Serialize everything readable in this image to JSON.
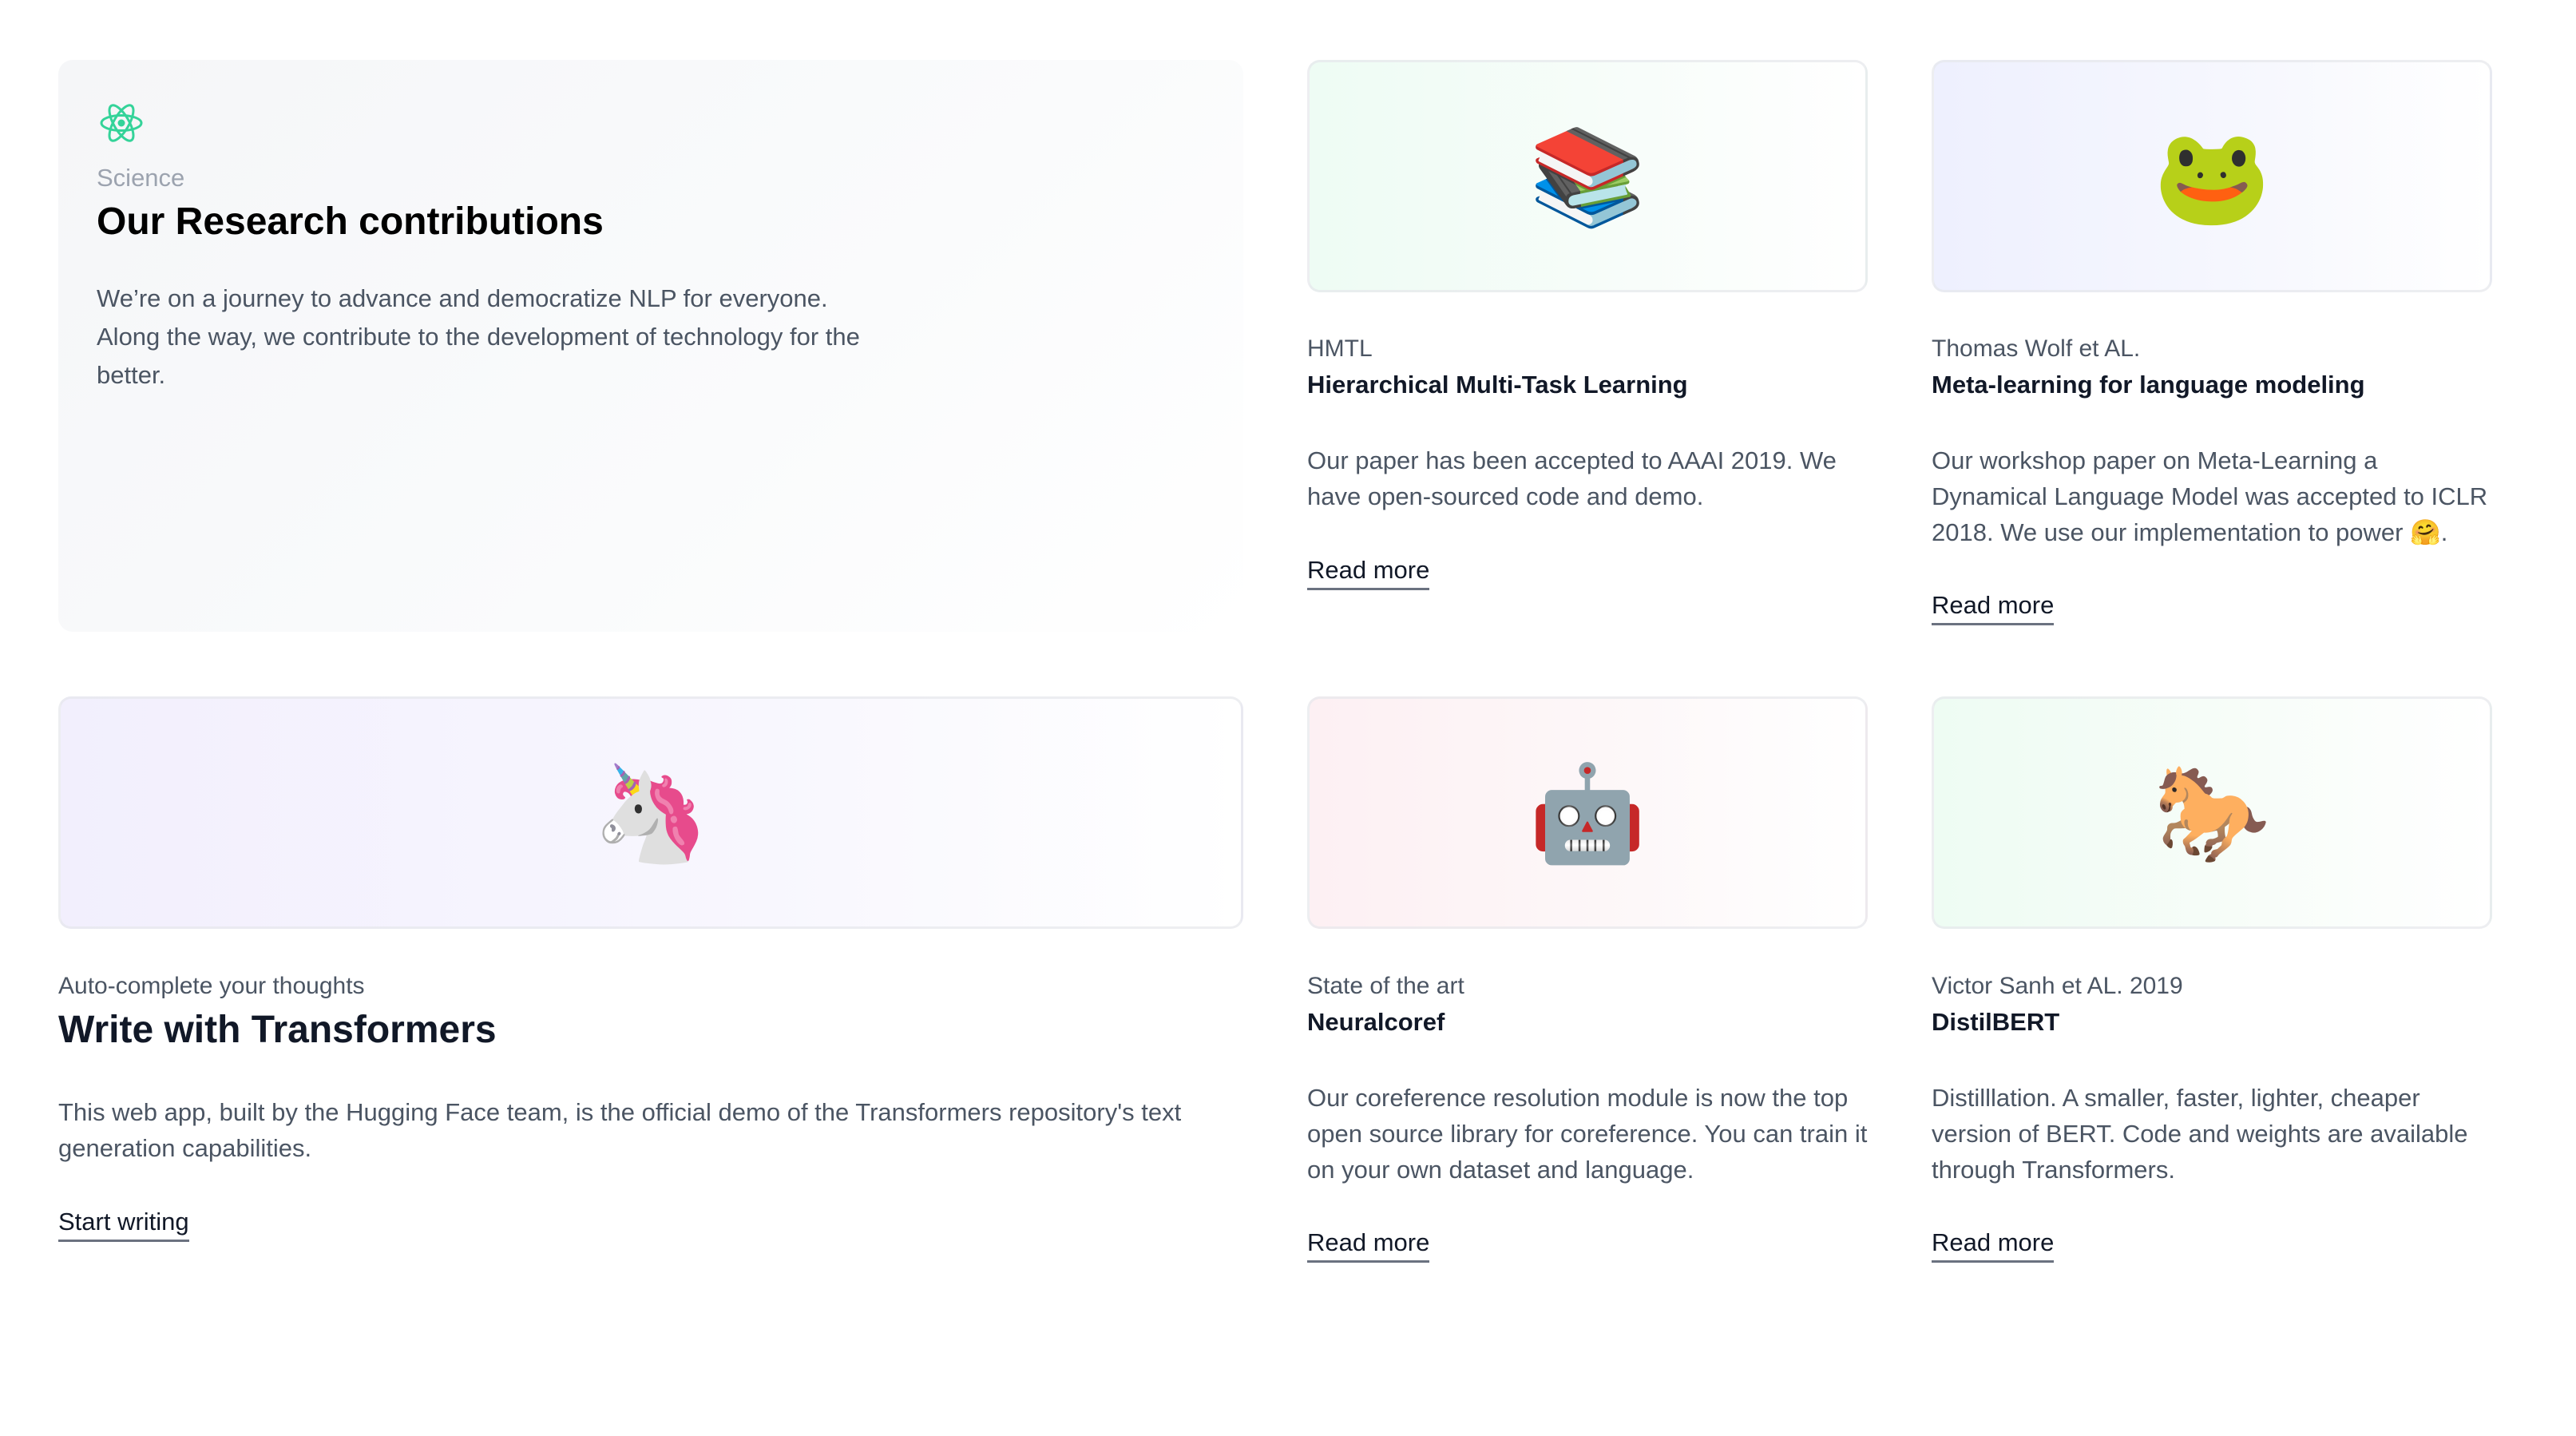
{
  "intro": {
    "icon": "atom-icon",
    "eyebrow": "Science",
    "title": "Our Research contributions",
    "description": "We’re on a journey to advance and democratize NLP for everyone. Along the way, we contribute to the development of technology for the better.",
    "accent_color": "#34d399"
  },
  "cards": {
    "hmtl": {
      "emoji": "📚",
      "icon": "books-icon",
      "eyebrow": "HMTL",
      "title": "Hierarchical Multi-Task Learning",
      "description": "Our paper has been accepted to AAAI 2019. We have open-sourced code and demo.",
      "link": "Read more"
    },
    "meta": {
      "emoji": "🐸",
      "icon": "frog-icon",
      "eyebrow": "Thomas Wolf et AL.",
      "title": "Meta-learning for language modeling",
      "description": "Our workshop paper on Meta-Learning a Dynamical Language Model was accepted to ICLR 2018. We use our implementation to power 🤗.",
      "link": "Read more"
    },
    "transformers": {
      "emoji": "🦄",
      "icon": "unicorn-icon",
      "eyebrow": "Auto-complete your thoughts",
      "title": "Write with Transformers",
      "description": "This web app, built by the Hugging Face team, is the official demo of the Transformers repository's text generation capabilities.",
      "link": "Start writing"
    },
    "neuralcoref": {
      "emoji": "🤖",
      "icon": "robot-icon",
      "eyebrow": "State of the art",
      "title": "Neuralcoref",
      "description": "Our coreference resolution module is now the top open source library for coreference. You can train it on your own dataset and language.",
      "link": "Read more"
    },
    "distilbert": {
      "emoji": "🐎",
      "icon": "horse-icon",
      "eyebrow": "Victor Sanh et AL. 2019",
      "title": "DistilBERT",
      "description": "Distilllation. A smaller, faster, lighter, cheaper version of BERT. Code and weights are available through Transformers.",
      "link": "Read more"
    }
  }
}
